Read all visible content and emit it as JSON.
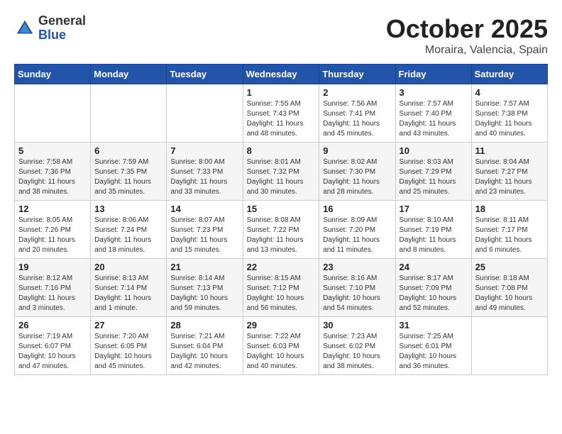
{
  "header": {
    "logo_general": "General",
    "logo_blue": "Blue",
    "month": "October 2025",
    "location": "Moraira, Valencia, Spain"
  },
  "days_of_week": [
    "Sunday",
    "Monday",
    "Tuesday",
    "Wednesday",
    "Thursday",
    "Friday",
    "Saturday"
  ],
  "weeks": [
    {
      "days": [
        {
          "number": "",
          "sunrise": "",
          "sunset": "",
          "daylight": "",
          "empty": true
        },
        {
          "number": "",
          "sunrise": "",
          "sunset": "",
          "daylight": "",
          "empty": true
        },
        {
          "number": "",
          "sunrise": "",
          "sunset": "",
          "daylight": "",
          "empty": true
        },
        {
          "number": "1",
          "sunrise": "Sunrise: 7:55 AM",
          "sunset": "Sunset: 7:43 PM",
          "daylight": "Daylight: 11 hours and 48 minutes."
        },
        {
          "number": "2",
          "sunrise": "Sunrise: 7:56 AM",
          "sunset": "Sunset: 7:41 PM",
          "daylight": "Daylight: 11 hours and 45 minutes."
        },
        {
          "number": "3",
          "sunrise": "Sunrise: 7:57 AM",
          "sunset": "Sunset: 7:40 PM",
          "daylight": "Daylight: 11 hours and 43 minutes."
        },
        {
          "number": "4",
          "sunrise": "Sunrise: 7:57 AM",
          "sunset": "Sunset: 7:38 PM",
          "daylight": "Daylight: 11 hours and 40 minutes."
        }
      ]
    },
    {
      "days": [
        {
          "number": "5",
          "sunrise": "Sunrise: 7:58 AM",
          "sunset": "Sunset: 7:36 PM",
          "daylight": "Daylight: 11 hours and 38 minutes."
        },
        {
          "number": "6",
          "sunrise": "Sunrise: 7:59 AM",
          "sunset": "Sunset: 7:35 PM",
          "daylight": "Daylight: 11 hours and 35 minutes."
        },
        {
          "number": "7",
          "sunrise": "Sunrise: 8:00 AM",
          "sunset": "Sunset: 7:33 PM",
          "daylight": "Daylight: 11 hours and 33 minutes."
        },
        {
          "number": "8",
          "sunrise": "Sunrise: 8:01 AM",
          "sunset": "Sunset: 7:32 PM",
          "daylight": "Daylight: 11 hours and 30 minutes."
        },
        {
          "number": "9",
          "sunrise": "Sunrise: 8:02 AM",
          "sunset": "Sunset: 7:30 PM",
          "daylight": "Daylight: 11 hours and 28 minutes."
        },
        {
          "number": "10",
          "sunrise": "Sunrise: 8:03 AM",
          "sunset": "Sunset: 7:29 PM",
          "daylight": "Daylight: 11 hours and 25 minutes."
        },
        {
          "number": "11",
          "sunrise": "Sunrise: 8:04 AM",
          "sunset": "Sunset: 7:27 PM",
          "daylight": "Daylight: 11 hours and 23 minutes."
        }
      ]
    },
    {
      "days": [
        {
          "number": "12",
          "sunrise": "Sunrise: 8:05 AM",
          "sunset": "Sunset: 7:26 PM",
          "daylight": "Daylight: 11 hours and 20 minutes."
        },
        {
          "number": "13",
          "sunrise": "Sunrise: 8:06 AM",
          "sunset": "Sunset: 7:24 PM",
          "daylight": "Daylight: 11 hours and 18 minutes."
        },
        {
          "number": "14",
          "sunrise": "Sunrise: 8:07 AM",
          "sunset": "Sunset: 7:23 PM",
          "daylight": "Daylight: 11 hours and 15 minutes."
        },
        {
          "number": "15",
          "sunrise": "Sunrise: 8:08 AM",
          "sunset": "Sunset: 7:22 PM",
          "daylight": "Daylight: 11 hours and 13 minutes."
        },
        {
          "number": "16",
          "sunrise": "Sunrise: 8:09 AM",
          "sunset": "Sunset: 7:20 PM",
          "daylight": "Daylight: 11 hours and 11 minutes."
        },
        {
          "number": "17",
          "sunrise": "Sunrise: 8:10 AM",
          "sunset": "Sunset: 7:19 PM",
          "daylight": "Daylight: 11 hours and 8 minutes."
        },
        {
          "number": "18",
          "sunrise": "Sunrise: 8:11 AM",
          "sunset": "Sunset: 7:17 PM",
          "daylight": "Daylight: 11 hours and 6 minutes."
        }
      ]
    },
    {
      "days": [
        {
          "number": "19",
          "sunrise": "Sunrise: 8:12 AM",
          "sunset": "Sunset: 7:16 PM",
          "daylight": "Daylight: 11 hours and 3 minutes."
        },
        {
          "number": "20",
          "sunrise": "Sunrise: 8:13 AM",
          "sunset": "Sunset: 7:14 PM",
          "daylight": "Daylight: 11 hours and 1 minute."
        },
        {
          "number": "21",
          "sunrise": "Sunrise: 8:14 AM",
          "sunset": "Sunset: 7:13 PM",
          "daylight": "Daylight: 10 hours and 59 minutes."
        },
        {
          "number": "22",
          "sunrise": "Sunrise: 8:15 AM",
          "sunset": "Sunset: 7:12 PM",
          "daylight": "Daylight: 10 hours and 56 minutes."
        },
        {
          "number": "23",
          "sunrise": "Sunrise: 8:16 AM",
          "sunset": "Sunset: 7:10 PM",
          "daylight": "Daylight: 10 hours and 54 minutes."
        },
        {
          "number": "24",
          "sunrise": "Sunrise: 8:17 AM",
          "sunset": "Sunset: 7:09 PM",
          "daylight": "Daylight: 10 hours and 52 minutes."
        },
        {
          "number": "25",
          "sunrise": "Sunrise: 8:18 AM",
          "sunset": "Sunset: 7:08 PM",
          "daylight": "Daylight: 10 hours and 49 minutes."
        }
      ]
    },
    {
      "days": [
        {
          "number": "26",
          "sunrise": "Sunrise: 7:19 AM",
          "sunset": "Sunset: 6:07 PM",
          "daylight": "Daylight: 10 hours and 47 minutes."
        },
        {
          "number": "27",
          "sunrise": "Sunrise: 7:20 AM",
          "sunset": "Sunset: 6:05 PM",
          "daylight": "Daylight: 10 hours and 45 minutes."
        },
        {
          "number": "28",
          "sunrise": "Sunrise: 7:21 AM",
          "sunset": "Sunset: 6:04 PM",
          "daylight": "Daylight: 10 hours and 42 minutes."
        },
        {
          "number": "29",
          "sunrise": "Sunrise: 7:22 AM",
          "sunset": "Sunset: 6:03 PM",
          "daylight": "Daylight: 10 hours and 40 minutes."
        },
        {
          "number": "30",
          "sunrise": "Sunrise: 7:23 AM",
          "sunset": "Sunset: 6:02 PM",
          "daylight": "Daylight: 10 hours and 38 minutes."
        },
        {
          "number": "31",
          "sunrise": "Sunrise: 7:25 AM",
          "sunset": "Sunset: 6:01 PM",
          "daylight": "Daylight: 10 hours and 36 minutes."
        },
        {
          "number": "",
          "sunrise": "",
          "sunset": "",
          "daylight": "",
          "empty": true
        }
      ]
    }
  ]
}
